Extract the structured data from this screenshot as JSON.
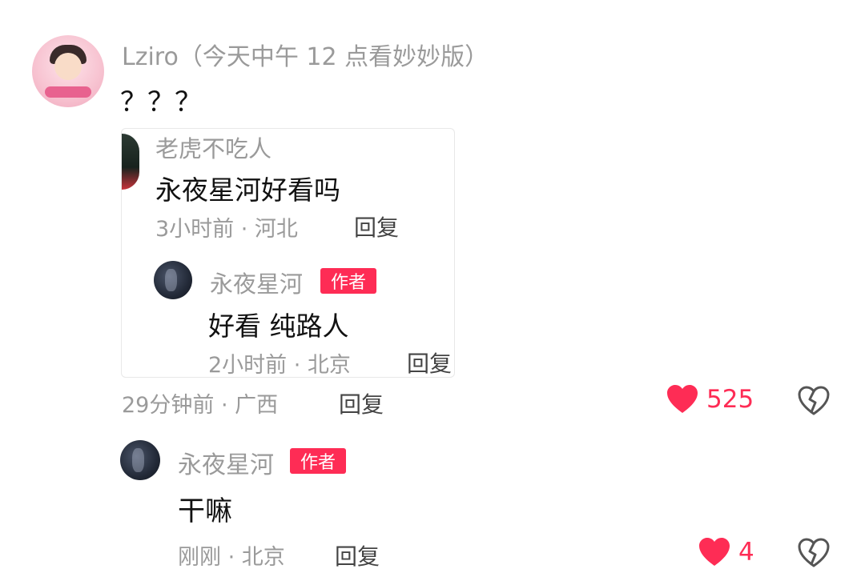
{
  "comment": {
    "username": "Lziro（今天中午 12 点看妙妙版）",
    "text": "？？？",
    "time_location": "29分钟前 · 广西",
    "reply_label": "回复",
    "likes": "525",
    "liked": true
  },
  "quote": {
    "username": "老虎不吃人",
    "text": "永夜星河好看吗",
    "time_location": "3小时前 · 河北",
    "reply_label": "回复",
    "reply": {
      "username": "永夜星河",
      "badge": "作者",
      "text": "好看 纯路人",
      "time_location": "2小时前 · 北京",
      "reply_label": "回复"
    }
  },
  "author_reply": {
    "username": "永夜星河",
    "badge": "作者",
    "text": "干嘛",
    "time_location": "刚刚 · 北京",
    "reply_label": "回复",
    "likes": "4",
    "liked": true
  },
  "icons": {
    "like": "heart-icon",
    "dislike": "broken-heart-icon"
  },
  "colors": {
    "accent": "#fe2c55",
    "muted": "#9a9a9a",
    "text": "#111111"
  }
}
